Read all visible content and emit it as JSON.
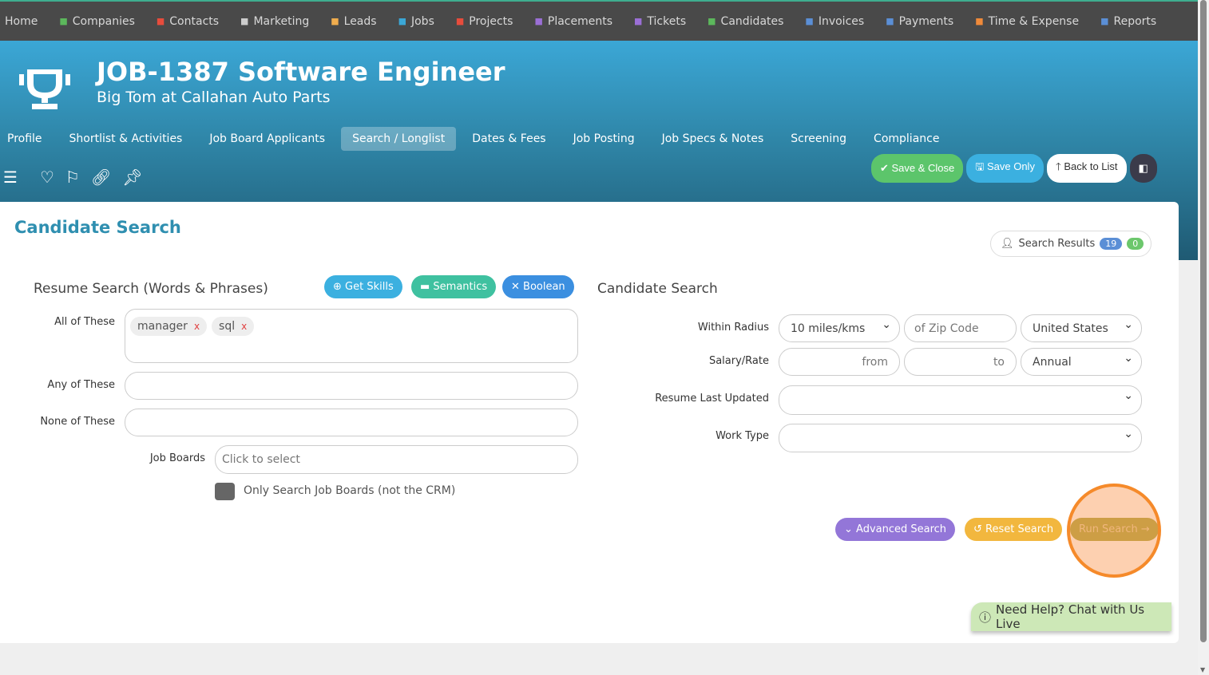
{
  "topnav": [
    {
      "label": "Home",
      "icon": "home",
      "color": "#d8d8d8"
    },
    {
      "label": "Companies",
      "icon": "building-icon",
      "color": "#5cb85c"
    },
    {
      "label": "Contacts",
      "icon": "contact-icon",
      "color": "#e74c3c"
    },
    {
      "label": "Marketing",
      "icon": "broadcast-icon",
      "color": "#cccccc"
    },
    {
      "label": "Leads",
      "icon": "target-icon",
      "color": "#f0ad4e"
    },
    {
      "label": "Jobs",
      "icon": "trophy-icon",
      "color": "#3ba7d6"
    },
    {
      "label": "Projects",
      "icon": "checkbox-icon",
      "color": "#e74c3c"
    },
    {
      "label": "Placements",
      "icon": "briefcase-icon",
      "color": "#9b6fd6"
    },
    {
      "label": "Tickets",
      "icon": "tag-icon",
      "color": "#9b6fd6"
    },
    {
      "label": "Candidates",
      "icon": "users-icon",
      "color": "#5cb85c"
    },
    {
      "label": "Invoices",
      "icon": "document-icon",
      "color": "#5b8fd6"
    },
    {
      "label": "Payments",
      "icon": "coins-icon",
      "color": "#5b8fd6"
    },
    {
      "label": "Time & Expense",
      "icon": "clock-icon",
      "color": "#f08a3a"
    },
    {
      "label": "Reports",
      "icon": "chart-icon",
      "color": "#5b8fd6"
    }
  ],
  "header": {
    "title": "JOB-1387 Software Engineer",
    "subtitle": "Big Tom at Callahan Auto Parts"
  },
  "tabs": [
    "Profile",
    "Shortlist & Activities",
    "Job Board Applicants",
    "Search / Longlist",
    "Dates & Fees",
    "Job Posting",
    "Job Specs & Notes",
    "Screening",
    "Compliance"
  ],
  "actions": {
    "save_close": "✔ Save & Close",
    "save_only": "🖫 Save Only",
    "back": "🡑 Back to List"
  },
  "page": {
    "title": "Candidate Search",
    "search_results": "Search Results",
    "count_blue": "19",
    "count_green": "0"
  },
  "resume": {
    "title": "Resume Search (Words & Phrases)",
    "get_skills": "Get Skills",
    "semantics": "Semantics",
    "boolean": "Boolean",
    "all_label": "All of These",
    "chips": [
      "manager",
      "sql"
    ],
    "any_label": "Any of These",
    "none_label": "None of These",
    "boards_label": "Job Boards",
    "boards_placeholder": "Click to select",
    "only_boards": "Only Search Job Boards (not the CRM)"
  },
  "candidate": {
    "title": "Candidate Search",
    "radius_label": "Within Radius",
    "radius": "10 miles/kms",
    "zip_placeholder": "of Zip Code",
    "country": "United States",
    "salary_label": "Salary/Rate",
    "from": "from",
    "to": "to",
    "period": "Annual",
    "updated_label": "Resume Last Updated",
    "worktype_label": "Work Type"
  },
  "buttons": {
    "advanced": "Advanced Search",
    "reset": "Reset Search",
    "run": "Run Search"
  },
  "help": "Need Help? Chat with Us Live"
}
